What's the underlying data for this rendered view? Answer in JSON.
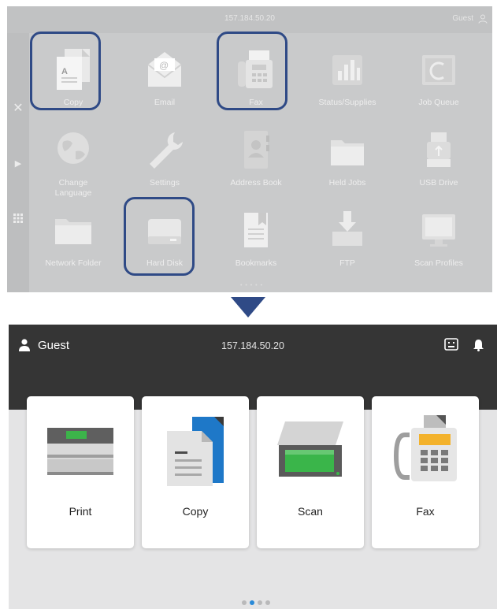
{
  "old_ui": {
    "ip": "157.184.50.20",
    "user": "Guest",
    "tiles": [
      {
        "label": "Copy",
        "icon": "copy-doc-icon"
      },
      {
        "label": "Email",
        "icon": "email-envelope-icon"
      },
      {
        "label": "Fax",
        "icon": "fax-machine-icon"
      },
      {
        "label": "Status/Supplies",
        "icon": "status-bars-icon"
      },
      {
        "label": "Job Queue",
        "icon": "job-queue-icon"
      },
      {
        "label": "Change Language",
        "icon": "globe-icon"
      },
      {
        "label": "Settings",
        "icon": "wrench-icon"
      },
      {
        "label": "Address Book",
        "icon": "address-book-icon"
      },
      {
        "label": "Held Jobs",
        "icon": "folder-icon"
      },
      {
        "label": "USB Drive",
        "icon": "usb-drive-icon"
      },
      {
        "label": "Network Folder",
        "icon": "network-folder-icon"
      },
      {
        "label": "Hard Disk",
        "icon": "hard-disk-icon"
      },
      {
        "label": "Bookmarks",
        "icon": "bookmark-icon"
      },
      {
        "label": "FTP",
        "icon": "ftp-tray-icon"
      },
      {
        "label": "Scan Profiles",
        "icon": "monitor-icon"
      }
    ],
    "highlight_color": "#2f4a86"
  },
  "new_ui": {
    "user": "Guest",
    "ip": "157.184.50.20",
    "cards": [
      {
        "label": "Print",
        "icon": "printer-icon"
      },
      {
        "label": "Copy",
        "icon": "copy-pages-icon"
      },
      {
        "label": "Scan",
        "icon": "scanner-icon"
      },
      {
        "label": "Fax",
        "icon": "fax-phone-icon"
      }
    ],
    "pager": {
      "total": 4,
      "active": 2
    },
    "accent_color": "#2a8ad8",
    "header_color": "#353535"
  }
}
